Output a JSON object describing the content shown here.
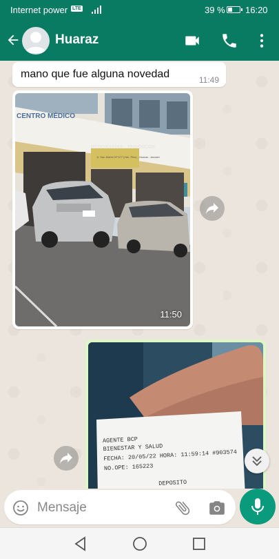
{
  "status": {
    "carrier": "Internet power",
    "network": "LTE",
    "battery_pct": "39 %",
    "battery_level": 0.39,
    "time": "16:20"
  },
  "header": {
    "title": "Huaraz",
    "icons": [
      "back-arrow-icon",
      "avatar",
      "video-call-icon",
      "phone-icon",
      "more-vert-icon"
    ]
  },
  "messages": [
    {
      "type": "text",
      "direction": "in",
      "text": "mano que fue alguna novedad",
      "time": "11:49"
    },
    {
      "type": "image",
      "direction": "in",
      "time": "11:50",
      "sign_main": "CENTRO MÉDICO",
      "sign_sub": "ECOGRAFÍAS - ENDOSCOP",
      "sign_addr": "Jr. San Martín Nº 677 (2do. Piso) - Huaraz - Ancash"
    },
    {
      "type": "image",
      "direction": "out",
      "receipt": {
        "line1": "AGENTE BCP",
        "line2": "BIENESTAR Y SALUD",
        "line3": "FECHA: 20/05/22 HORA: 11:59:14 #903574",
        "line4": "NO.OPE: 165223",
        "line5": "DEPOSITO"
      }
    }
  ],
  "composer": {
    "placeholder": "Mensaje"
  }
}
